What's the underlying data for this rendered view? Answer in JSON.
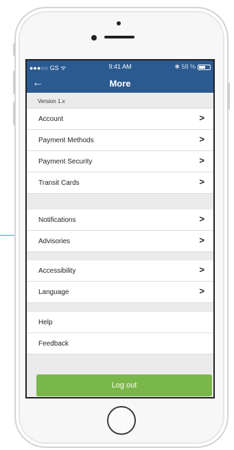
{
  "status_bar": {
    "carrier": "●●●○○ GS ᯤ",
    "time": "9:41 AM",
    "battery_text": "✱ 58 %",
    "battery_level": 0.58
  },
  "nav": {
    "back_icon": "←",
    "title": "More"
  },
  "version": "Version 1.x",
  "chevron": ">",
  "menu": {
    "account": "Account",
    "payment_methods": "Payment Methods",
    "payment_security": "Payment Security",
    "transit_cards": "Transit Cards",
    "notifications": "Notifications",
    "advisories": "Advisories",
    "accessibility": "Accessibility",
    "language": "Language",
    "help": "Help",
    "feedback": "Feedback"
  },
  "logout_label": "Log out",
  "colors": {
    "header": "#2b5a90",
    "logout": "#7ab74a",
    "callout": "#3aa3c8"
  }
}
